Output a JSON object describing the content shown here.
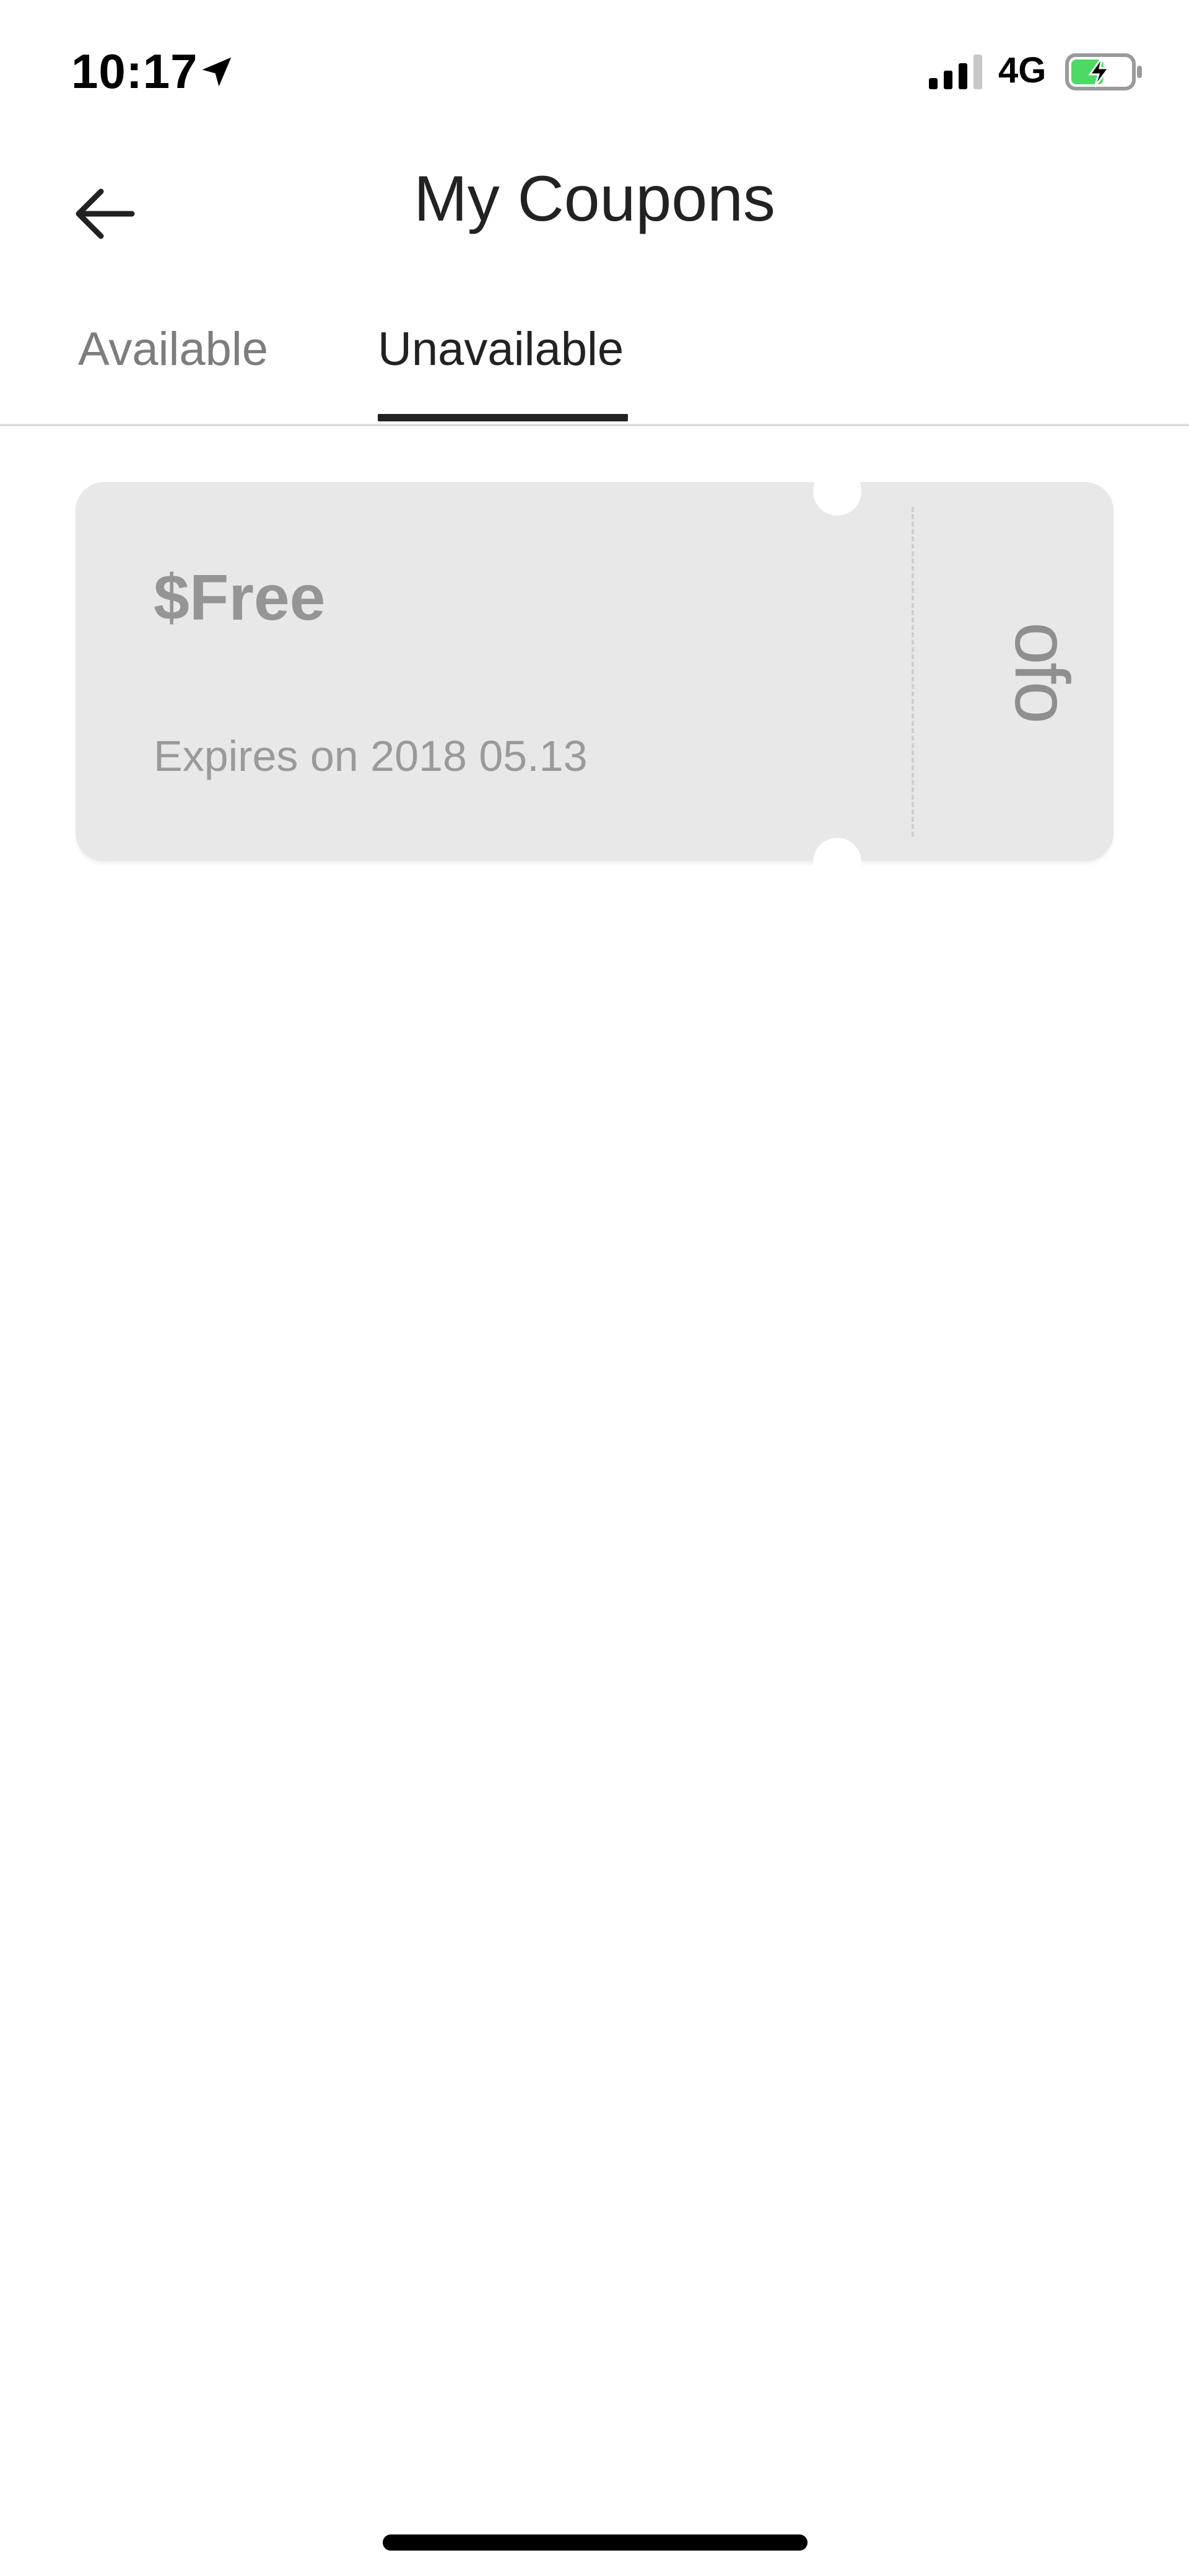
{
  "status_bar": {
    "time": "10:17",
    "network": "4G",
    "location_icon": "location-arrow-icon",
    "signal_icon": "signal-bars-icon",
    "battery_icon": "battery-charging-icon",
    "battery_fill_fraction": 0.55,
    "battery_color": "#4cd964"
  },
  "header": {
    "title": "My Coupons",
    "back_icon": "arrow-left-icon"
  },
  "tabs": {
    "items": [
      {
        "label": "Available",
        "active": false
      },
      {
        "label": "Unavailable",
        "active": true
      }
    ]
  },
  "coupons": [
    {
      "amount": "$Free",
      "expiry": "Expires on 2018 05.13",
      "brand": "ofo",
      "state": "unavailable"
    }
  ],
  "colors": {
    "card_background": "#e8e8e8",
    "muted_text": "#959595",
    "active_tab": "#222222",
    "inactive_tab": "#7d7d7d"
  }
}
